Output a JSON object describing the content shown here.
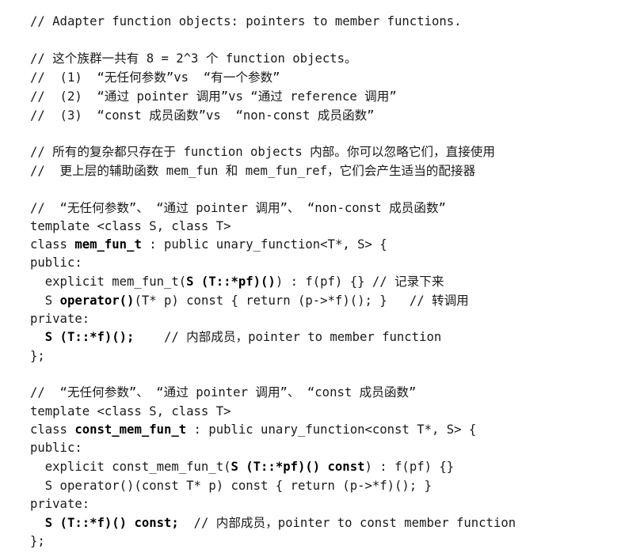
{
  "lines": [
    {
      "id": "l01",
      "segments": [
        {
          "text": "// Adapter function objects: pointers to member functions."
        }
      ]
    },
    {
      "id": "l02",
      "segments": [
        {
          "text": "// 这个族群一共有 8 = 2^3 个 function objects。"
        }
      ]
    },
    {
      "id": "l03",
      "segments": [
        {
          "text": "//  (1)  “无任何参数”vs  “有一个参数”"
        }
      ]
    },
    {
      "id": "l04",
      "segments": [
        {
          "text": "//  (2)  “通过 pointer 调用”vs “通过 reference 调用”"
        }
      ]
    },
    {
      "id": "l05",
      "segments": [
        {
          "text": "//  (3)  “const 成员函数”vs  “non-const 成员函数”"
        }
      ]
    },
    {
      "id": "l06",
      "segments": [
        {
          "text": "// 所有的复杂都只存在于 function objects 内部。你可以忽略它们，直接使用"
        }
      ]
    },
    {
      "id": "l07",
      "segments": [
        {
          "text": "//  更上层的辅助函数 mem_fun 和 mem_fun_ref，它们会产生适当的配接器"
        }
      ]
    },
    {
      "id": "l08",
      "segments": [
        {
          "text": "//  “无任何参数”、 “通过 pointer 调用”、 “non-const 成员函数”"
        }
      ]
    },
    {
      "id": "l09",
      "segments": [
        {
          "text": "template <class S, class T>"
        }
      ]
    },
    {
      "id": "l10",
      "segments": [
        {
          "text": "class "
        },
        {
          "text": "mem_fun_t",
          "bold": true
        },
        {
          "text": " : public unary_function<T*, S> {"
        }
      ]
    },
    {
      "id": "l11",
      "segments": [
        {
          "text": "public:"
        }
      ]
    },
    {
      "id": "l12",
      "segments": [
        {
          "text": "  explicit mem_fun_t("
        },
        {
          "text": "S (T::*pf)()",
          "bold": true
        },
        {
          "text": ") : f(pf) {} // 记录下来"
        }
      ]
    },
    {
      "id": "l13",
      "segments": [
        {
          "text": "  S "
        },
        {
          "text": "operator()",
          "bold": true
        },
        {
          "text": "(T* p) const { return (p->*f)(); }   // 转调用"
        }
      ]
    },
    {
      "id": "l14",
      "segments": [
        {
          "text": "private:"
        }
      ]
    },
    {
      "id": "l15",
      "segments": [
        {
          "text": "  "
        },
        {
          "text": "S (T::*f)();",
          "bold": true
        },
        {
          "text": "    // 内部成员，pointer to member function"
        }
      ]
    },
    {
      "id": "l16",
      "segments": [
        {
          "text": "};"
        }
      ]
    },
    {
      "id": "l17",
      "segments": [
        {
          "text": "//  “无任何参数”、 “通过 pointer 调用”、 “const 成员函数”"
        }
      ]
    },
    {
      "id": "l18",
      "segments": [
        {
          "text": "template <class S, class T>"
        }
      ]
    },
    {
      "id": "l19",
      "segments": [
        {
          "text": "class "
        },
        {
          "text": "const_mem_fun_t",
          "bold": true
        },
        {
          "text": " : public unary_function<const T*, S> {"
        }
      ]
    },
    {
      "id": "l20",
      "segments": [
        {
          "text": "public:"
        }
      ]
    },
    {
      "id": "l21",
      "segments": [
        {
          "text": "  explicit const_mem_fun_t("
        },
        {
          "text": "S (T::*pf)() const",
          "bold": true
        },
        {
          "text": ") : f(pf) {}"
        }
      ]
    },
    {
      "id": "l22",
      "segments": [
        {
          "text": "  S operator()(const T* p) const { return (p->*f)(); }"
        }
      ]
    },
    {
      "id": "l23",
      "segments": [
        {
          "text": "private:"
        }
      ]
    },
    {
      "id": "l24",
      "segments": [
        {
          "text": "  "
        },
        {
          "text": "S (T::*f)() const;",
          "bold": true
        },
        {
          "text": "  // 内部成员，pointer to const member function"
        }
      ]
    },
    {
      "id": "l25",
      "segments": [
        {
          "text": "};"
        }
      ]
    }
  ]
}
